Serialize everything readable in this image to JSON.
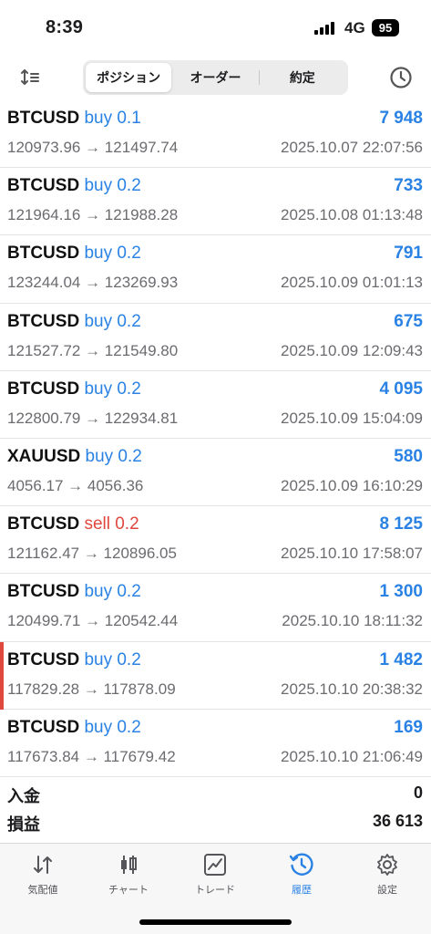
{
  "status_bar": {
    "time": "8:39",
    "network": "4G",
    "battery": "95"
  },
  "toolbar": {
    "tabs": [
      {
        "label": "ポジション",
        "active": true
      },
      {
        "label": "オーダー",
        "active": false
      },
      {
        "label": "約定",
        "active": false
      }
    ],
    "icons": {
      "sort": "sort-icon",
      "history": "clock-icon"
    }
  },
  "deals": [
    {
      "symbol": "BTCUSD",
      "side": "buy",
      "volume": "buy 0.1",
      "profit": "7 948",
      "prices": "120973.96 → 121497.74",
      "time": "2025.10.07 22:07:56",
      "marked": false
    },
    {
      "symbol": "BTCUSD",
      "side": "buy",
      "volume": "buy 0.2",
      "profit": "733",
      "prices": "121964.16 → 121988.28",
      "time": "2025.10.08 01:13:48",
      "marked": false
    },
    {
      "symbol": "BTCUSD",
      "side": "buy",
      "volume": "buy 0.2",
      "profit": "791",
      "prices": "123244.04 → 123269.93",
      "time": "2025.10.09 01:01:13",
      "marked": false
    },
    {
      "symbol": "BTCUSD",
      "side": "buy",
      "volume": "buy 0.2",
      "profit": "675",
      "prices": "121527.72 → 121549.80",
      "time": "2025.10.09 12:09:43",
      "marked": false
    },
    {
      "symbol": "BTCUSD",
      "side": "buy",
      "volume": "buy 0.2",
      "profit": "4 095",
      "prices": "122800.79 → 122934.81",
      "time": "2025.10.09 15:04:09",
      "marked": false
    },
    {
      "symbol": "XAUUSD",
      "side": "buy",
      "volume": "buy 0.2",
      "profit": "580",
      "prices": "4056.17 → 4056.36",
      "time": "2025.10.09 16:10:29",
      "marked": false
    },
    {
      "symbol": "BTCUSD",
      "side": "sell",
      "volume": "sell 0.2",
      "profit": "8 125",
      "prices": "121162.47 → 120896.05",
      "time": "2025.10.10 17:58:07",
      "marked": false
    },
    {
      "symbol": "BTCUSD",
      "side": "buy",
      "volume": "buy 0.2",
      "profit": "1 300",
      "prices": "120499.71 → 120542.44",
      "time": "2025.10.10 18:11:32",
      "marked": false
    },
    {
      "symbol": "BTCUSD",
      "side": "buy",
      "volume": "buy 0.2",
      "profit": "1 482",
      "prices": "117829.28 → 117878.09",
      "time": "2025.10.10 20:38:32",
      "marked": true
    },
    {
      "symbol": "BTCUSD",
      "side": "buy",
      "volume": "buy 0.2",
      "profit": "169",
      "prices": "117673.84 → 117679.42",
      "time": "2025.10.10 21:06:49",
      "marked": false
    }
  ],
  "summary": {
    "deposit_label": "入金",
    "deposit_value": "0",
    "pnl_label": "損益",
    "pnl_value": "36 613"
  },
  "tabbar": [
    {
      "label": "気配値",
      "icon": "quotes-icon",
      "active": false
    },
    {
      "label": "チャート",
      "icon": "candlestick-icon",
      "active": false
    },
    {
      "label": "トレード",
      "icon": "trade-chart-icon",
      "active": false
    },
    {
      "label": "履歴",
      "icon": "history-clock-icon",
      "active": true
    },
    {
      "label": "設定",
      "icon": "gear-icon",
      "active": false
    }
  ],
  "colors": {
    "buy": "#2a82e4",
    "sell": "#e0473e",
    "marker": "#e0473e",
    "accent": "#2a82e4"
  }
}
